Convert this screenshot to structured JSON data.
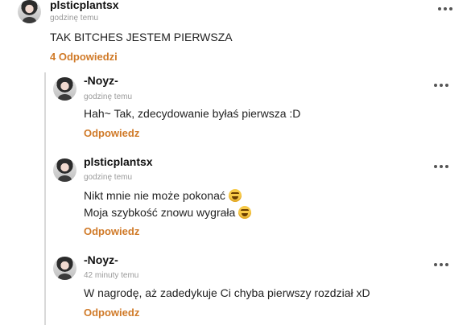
{
  "main_comment": {
    "username": "plsticplantsx",
    "time": "godzinę temu",
    "text": "TAK BITCHES JESTEM PIERWSZA",
    "replies_link": "4 Odpowiedzi"
  },
  "replies": [
    {
      "username": "-Noyz-",
      "time": "godzinę temu",
      "lines": [
        "Hah~ Tak, zdecydowanie byłaś pierwsza :D"
      ],
      "reply_label": "Odpowiedz"
    },
    {
      "username": "plsticplantsx",
      "time": "godzinę temu",
      "lines": [
        "Nikt mnie nie może pokonać",
        "Moja szybkość znowu wygrała"
      ],
      "emojis": [
        "grinning-sweat-emoji",
        "grinning-sweat-emoji"
      ],
      "reply_label": "Odpowiedz"
    },
    {
      "username": "-Noyz-",
      "time": "42 minuty temu",
      "lines": [
        "W nagrodę, aż zadedykuje Ci chyba pierwszy rozdział xD"
      ],
      "reply_label": "Odpowiedz"
    }
  ],
  "colors": {
    "accent": "#d07a28",
    "muted": "#9a9a9a",
    "text": "#222222"
  },
  "icons": {
    "more": "more-options-icon"
  }
}
